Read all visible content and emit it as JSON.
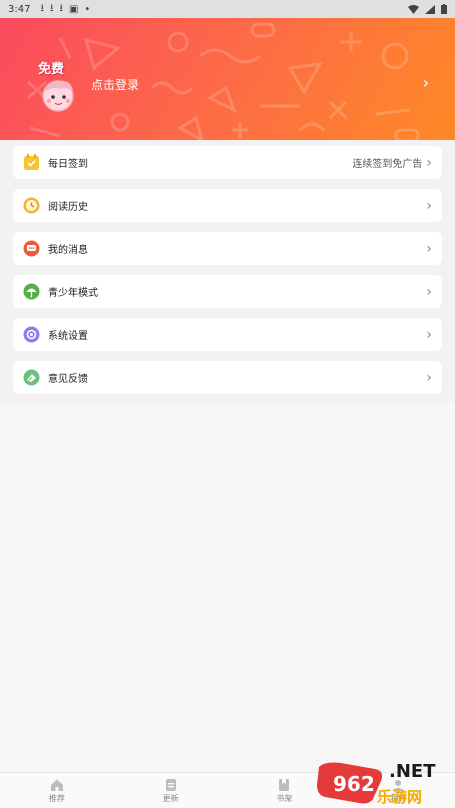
{
  "status_bar": {
    "time": "3:47",
    "icons": [
      "download-icon",
      "download-icon",
      "download-icon",
      "screenshot-icon",
      "dot-icon"
    ],
    "right_icons": [
      "wifi-icon",
      "signal-icon",
      "battery-icon"
    ]
  },
  "header": {
    "login_text": "点击登录",
    "avatar_badge": "免费",
    "background_colors": [
      "#fb4a5e",
      "#fd6f43",
      "#fe8a24"
    ]
  },
  "menu": {
    "items": [
      {
        "label": "每日签到",
        "sub": "连续签到免广告",
        "icon": "calendar-check-icon",
        "icon_color": "#f8c334"
      },
      {
        "label": "阅读历史",
        "sub": "",
        "icon": "clock-icon",
        "icon_color": "#f0b430"
      },
      {
        "label": "我的消息",
        "sub": "",
        "icon": "message-icon",
        "icon_color": "#f05a3c"
      },
      {
        "label": "青少年模式",
        "sub": "",
        "icon": "umbrella-icon",
        "icon_color": "#58b04a"
      },
      {
        "label": "系统设置",
        "sub": "",
        "icon": "gear-icon",
        "icon_color": "#8c7cf0"
      },
      {
        "label": "意见反馈",
        "sub": "",
        "icon": "feedback-icon",
        "icon_color": "#6cc07a"
      }
    ]
  },
  "tabbar": {
    "tabs": [
      {
        "label": "推荐",
        "icon": "home-icon"
      },
      {
        "label": "更新",
        "icon": "update-icon"
      },
      {
        "label": "书架",
        "icon": "bookshelf-icon"
      },
      {
        "label": "我的",
        "icon": "profile-icon"
      }
    ]
  },
  "watermark": {
    "text": ".NET",
    "logo_text": "962",
    "sub_text": "乐游网"
  }
}
